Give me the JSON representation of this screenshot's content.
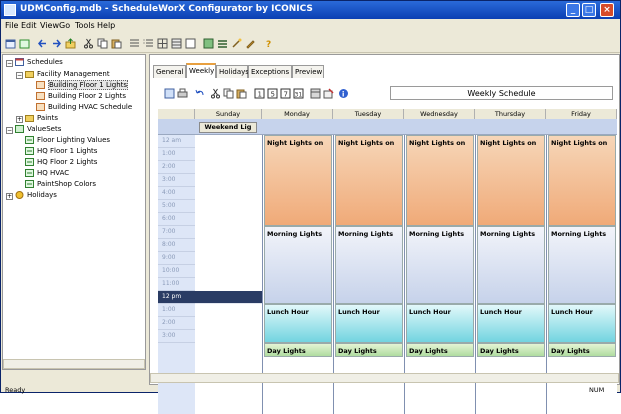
{
  "window": {
    "title": "UDMConfig.mdb - ScheduleWorX Configurator by ICONICS",
    "controls": {
      "minimize": "_",
      "maximize": "□",
      "close": "×"
    }
  },
  "menu": {
    "items": [
      "File",
      "Edit",
      "View",
      "Go",
      "Tools",
      "Help"
    ]
  },
  "tree": {
    "items": [
      {
        "label": "Schedules",
        "level": 0,
        "icon": "calendar-icon",
        "expanded": true
      },
      {
        "label": "Facility Management",
        "level": 1,
        "icon": "folder-icon",
        "expanded": true
      },
      {
        "label": "Building Floor 1 Lights",
        "level": 2,
        "icon": "schedule-icon",
        "selected": true
      },
      {
        "label": "Building Floor 2 Lights",
        "level": 2,
        "icon": "schedule-icon"
      },
      {
        "label": "Building HVAC Schedule",
        "level": 2,
        "icon": "schedule-icon"
      },
      {
        "label": "Paints",
        "level": 1,
        "icon": "folder-icon",
        "expanded": false
      },
      {
        "label": "ValueSets",
        "level": 0,
        "icon": "valueset-icon",
        "expanded": true
      },
      {
        "label": "Floor Lighting Values",
        "level": 1,
        "icon": "valueset-item-icon"
      },
      {
        "label": "HQ Floor 1 Lights",
        "level": 1,
        "icon": "valueset-item-icon"
      },
      {
        "label": "HQ Floor 2 Lights",
        "level": 1,
        "icon": "valueset-item-icon"
      },
      {
        "label": "HQ HVAC",
        "level": 1,
        "icon": "valueset-item-icon"
      },
      {
        "label": "PaintShop Colors",
        "level": 1,
        "icon": "valueset-item-icon"
      },
      {
        "label": "Holidays",
        "level": 0,
        "icon": "holiday-icon",
        "expanded": false
      }
    ]
  },
  "tabs": [
    "General",
    "Weekly",
    "Holidays",
    "Exceptions",
    "Preview"
  ],
  "active_tab": "Weekly",
  "weekly_schedule_title": "Weekly Schedule",
  "calendar": {
    "days": [
      "Sunday",
      "Monday",
      "Tuesday",
      "Wednesday",
      "Thursday",
      "Friday"
    ],
    "weekend_event": "Weekend Lig",
    "times": [
      "12 am",
      "1:00",
      "2:00",
      "3:00",
      "4:00",
      "5:00",
      "6:00",
      "7:00",
      "8:00",
      "9:00",
      "10:00",
      "11:00",
      "12 pm",
      "1:00",
      "2:00",
      "3:00"
    ],
    "events": {
      "night": "Night Lights on",
      "morning": "Morning Lights",
      "lunch": "Lunch Hour",
      "day": "Day Lights"
    }
  },
  "status": {
    "left": "Ready",
    "right": "NUM"
  }
}
